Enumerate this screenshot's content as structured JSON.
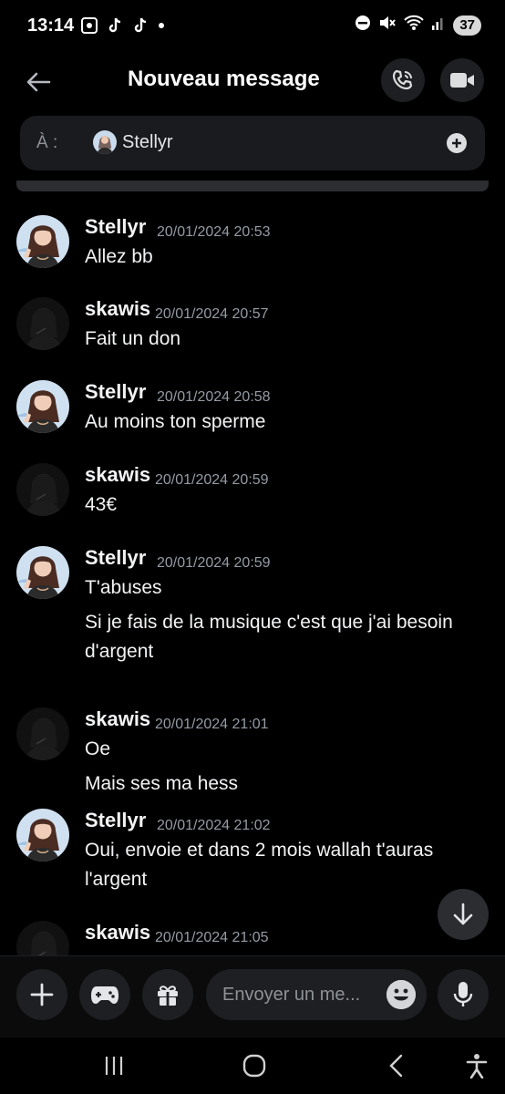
{
  "status_bar": {
    "time": "13:14",
    "battery": "37",
    "left_icons": [
      "screen-record-icon",
      "tiktok-icon",
      "tiktok-icon",
      "notification-dot"
    ],
    "right_icons": [
      "do-not-disturb-icon",
      "mute-icon",
      "wifi-icon",
      "signal-icon"
    ]
  },
  "header": {
    "title": "Nouveau message",
    "back_icon": "arrow-left-icon",
    "call_icon": "phone-call-icon",
    "video_icon": "video-camera-icon"
  },
  "recipient": {
    "prefix": "À :",
    "name": "Stellyr",
    "add_icon": "plus-circle-icon"
  },
  "messages": [
    {
      "author": "Stellyr",
      "timestamp": "20/01/2024 20:53",
      "lines": [
        "Allez bb"
      ]
    },
    {
      "author": "skawis",
      "timestamp": "20/01/2024 20:57",
      "lines": [
        "Fait  un don"
      ]
    },
    {
      "author": "Stellyr",
      "timestamp": "20/01/2024 20:58",
      "lines": [
        "Au moins ton sperme"
      ]
    },
    {
      "author": "skawis",
      "timestamp": "20/01/2024 20:59",
      "lines": [
        "43€"
      ]
    },
    {
      "author": "Stellyr",
      "timestamp": "20/01/2024 20:59",
      "lines": [
        "T'abuses",
        "Si je fais de la musique c'est que j'ai besoin",
        "d'argent"
      ]
    },
    {
      "author": "skawis",
      "timestamp": "20/01/2024 21:01",
      "lines": [
        "Oe",
        "Mais ses ma hess"
      ]
    },
    {
      "author": "Stellyr",
      "timestamp": "20/01/2024 21:02",
      "lines": [
        "Oui, envoie et dans 2 mois wallah t'auras",
        "l'argent"
      ]
    },
    {
      "author": "skawis",
      "timestamp": "20/01/2024 21:05",
      "lines": []
    }
  ],
  "composer": {
    "placeholder": "Envoyer un me...",
    "add_icon": "plus-icon",
    "games_icon": "gamepad-icon",
    "gift_icon": "gift-icon",
    "emoji_icon": "emoji-icon",
    "mic_icon": "microphone-icon"
  },
  "nav_bar": {
    "recents_icon": "recents-icon",
    "home_icon": "home-icon",
    "back_icon": "back-chevron-icon",
    "accessibility_icon": "accessibility-icon"
  },
  "colors": {
    "background": "#000000",
    "surface": "#1e1f22",
    "timestamp": "#949ba4",
    "text": "#f2f3f5"
  }
}
